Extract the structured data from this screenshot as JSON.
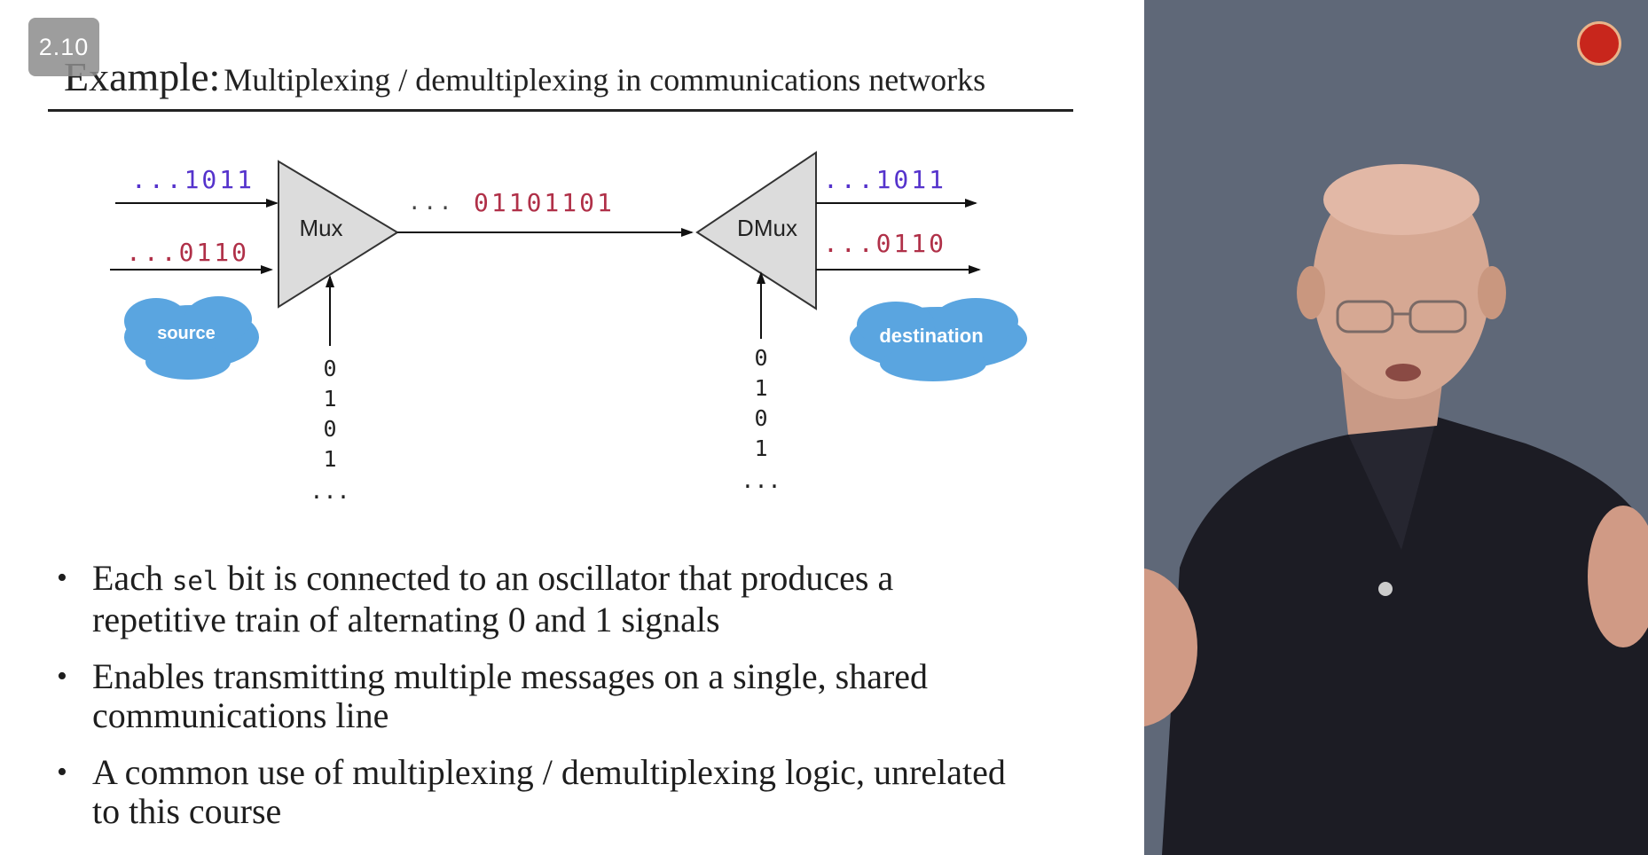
{
  "badge": {
    "version": "2.10"
  },
  "title": {
    "prefix": "Example:",
    "text": "Multiplexing / demultiplexing in communications networks"
  },
  "diagram": {
    "mux_label": "Mux",
    "dmux_label": "DMux",
    "input_top": "...1011",
    "input_bottom": "...0110",
    "line_dots": "...",
    "line_bits": "01101101",
    "output_top": "...1011",
    "output_bottom": "...0110",
    "source_label": "source",
    "destination_label": "destination",
    "mux_sel_bits": [
      "0",
      "1",
      "0",
      "1",
      "..."
    ],
    "dmux_sel_bits": [
      "0",
      "1",
      "0",
      "1",
      "..."
    ],
    "colors": {
      "blue_bits": "#5533cc",
      "red_bits": "#b03048",
      "cloud": "#5aa5e0",
      "gate_fill": "#dcdcdc"
    }
  },
  "bullets": {
    "b1_before": "Each ",
    "b1_code": "sel",
    "b1_after": " bit is connected to an oscillator that produces a repetitive train of alternating 0 and 1 signals",
    "b2": "Enables transmitting multiple messages on a single, shared communications line",
    "b3": "A common use of multiplexing / demultiplexing logic, unrelated to this course",
    "marker": "•"
  },
  "icons": {
    "logo": "presenter-logo-icon"
  }
}
